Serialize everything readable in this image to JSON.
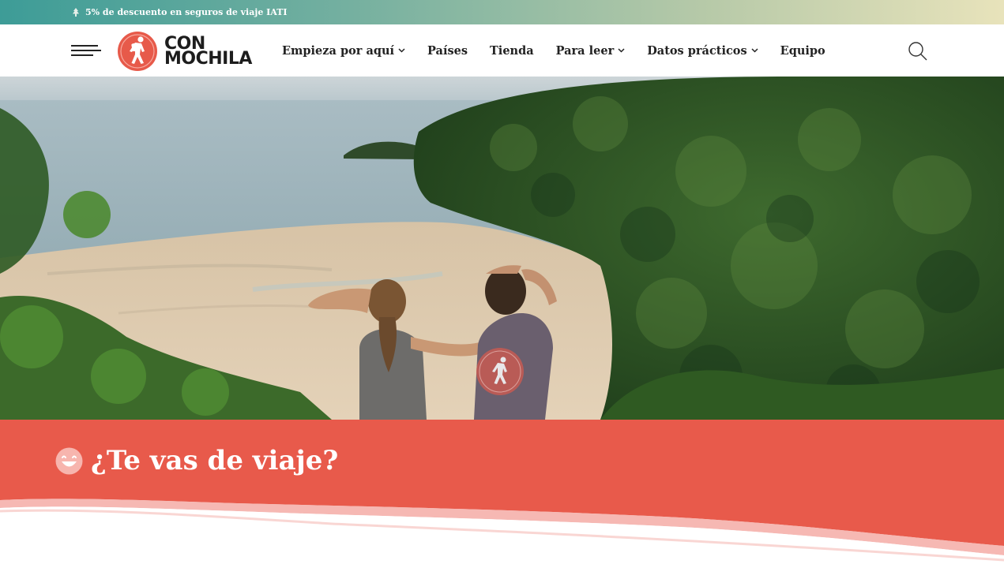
{
  "promo": {
    "icon": "tree-icon",
    "text": "5% de descuento en seguros de viaje IATI"
  },
  "header": {
    "logo": {
      "line1": "CON",
      "line2": "MOCHILA",
      "brand_color": "#e75a4a"
    },
    "nav": [
      {
        "label": "Empieza por aquí",
        "has_dropdown": true
      },
      {
        "label": "Países",
        "has_dropdown": false
      },
      {
        "label": "Tienda",
        "has_dropdown": false
      },
      {
        "label": "Para leer",
        "has_dropdown": true
      },
      {
        "label": "Datos prácticos",
        "has_dropdown": true
      },
      {
        "label": "Equipo",
        "has_dropdown": false
      }
    ],
    "menu_icon": "hamburger-icon",
    "search_icon": "search-icon"
  },
  "hero": {
    "image": "two-travelers-overlooking-jungle-beach"
  },
  "title_band": {
    "emoji": "grinning-face-icon",
    "title": "¿Te vas de viaje?",
    "color": "#e85a4b"
  }
}
